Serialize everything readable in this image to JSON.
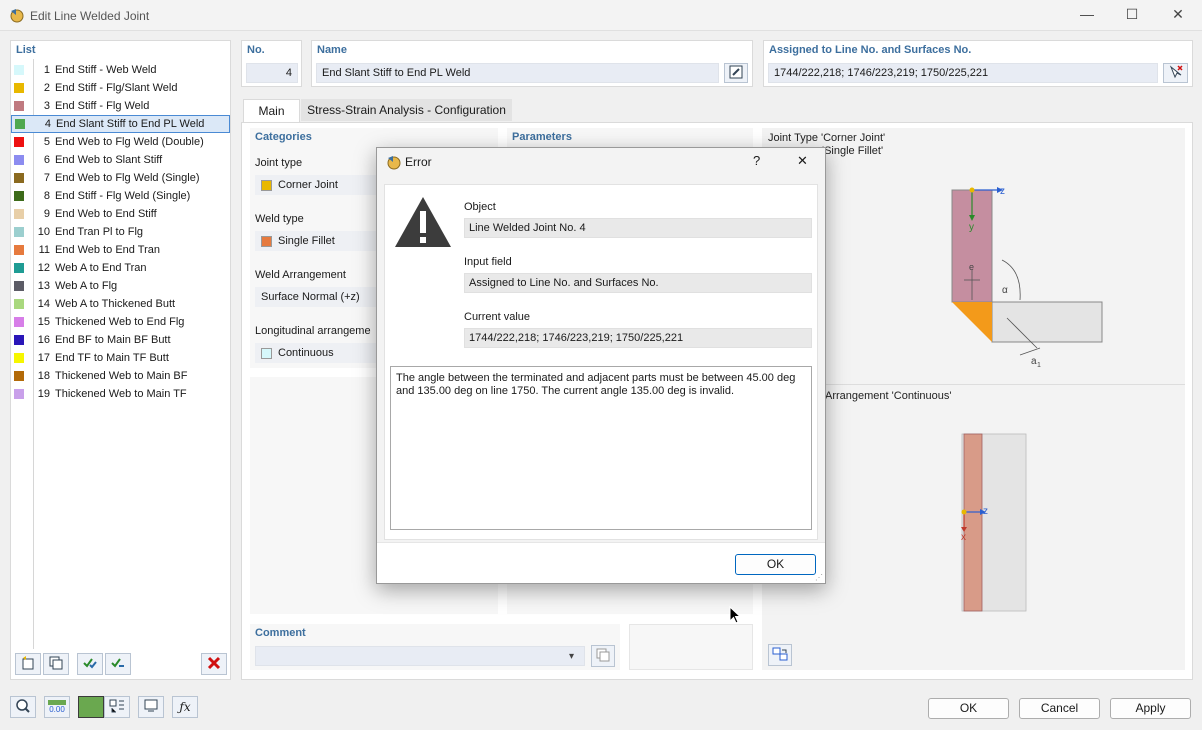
{
  "window": {
    "title": "Edit Line Welded Joint",
    "minimize_glyph": "—",
    "maximize_glyph": "☐",
    "close_glyph": "✕"
  },
  "list": {
    "header": "List",
    "selected_index": 3,
    "items": [
      {
        "num": "1",
        "label": "End Stiff - Web Weld",
        "color": "#d6f8fb"
      },
      {
        "num": "2",
        "label": "End Stiff - Flg/Slant Weld",
        "color": "#e8b800"
      },
      {
        "num": "3",
        "label": "End Stiff - Flg Weld",
        "color": "#c07a80"
      },
      {
        "num": "4",
        "label": "End Slant Stiff to End PL Weld",
        "color": "#4fa84f"
      },
      {
        "num": "5",
        "label": "End Web to Flg Weld (Double)",
        "color": "#ee1111"
      },
      {
        "num": "6",
        "label": "End Web to Slant Stiff",
        "color": "#8c8cf0"
      },
      {
        "num": "7",
        "label": "End Web to Flg Weld (Single)",
        "color": "#8b6a20"
      },
      {
        "num": "8",
        "label": "End Stiff - Flg Weld (Single)",
        "color": "#3d6b1a"
      },
      {
        "num": "9",
        "label": "End Web to End Stiff",
        "color": "#e8cfa8"
      },
      {
        "num": "10",
        "label": "End Tran Pl to Flg",
        "color": "#9ccfcf"
      },
      {
        "num": "11",
        "label": "End Web to End Tran",
        "color": "#e67a3e"
      },
      {
        "num": "12",
        "label": "Web A to End Tran",
        "color": "#1f9c94"
      },
      {
        "num": "13",
        "label": "Web A to Flg",
        "color": "#5c5c66"
      },
      {
        "num": "14",
        "label": "Web A to Thickened Butt",
        "color": "#a9d87e"
      },
      {
        "num": "15",
        "label": "Thickened Web to End Flg",
        "color": "#d77ee8"
      },
      {
        "num": "16",
        "label": "End BF to Main BF Butt",
        "color": "#2a16b8"
      },
      {
        "num": "17",
        "label": "End TF to Main TF Butt",
        "color": "#f6f600"
      },
      {
        "num": "18",
        "label": "Thickened Web to Main BF",
        "color": "#b36a08"
      },
      {
        "num": "19",
        "label": "Thickened Web to Main TF",
        "color": "#c9a0ea"
      }
    ]
  },
  "header_fields": {
    "no_label": "No.",
    "no_value": "4",
    "name_label": "Name",
    "name_value": "End Slant Stiff to End PL Weld",
    "assigned_label": "Assigned to Line No. and Surfaces No.",
    "assigned_value": "1744/222,218; 1746/223,219; 1750/225,221"
  },
  "tabs": [
    {
      "label": "Main",
      "active": true
    },
    {
      "label": "Stress-Strain Analysis - Configuration",
      "active": false
    }
  ],
  "categories": {
    "header": "Categories",
    "joint_type_label": "Joint type",
    "joint_type_value": "Corner Joint",
    "joint_type_color": "#e8b800",
    "weld_type_label": "Weld type",
    "weld_type_value": "Single Fillet",
    "weld_type_color": "#e67a3e",
    "weld_arrangement_label": "Weld Arrangement",
    "weld_arrangement_value": "Surface Normal (+z)",
    "longitudinal_label": "Longitudinal arrangeme",
    "longitudinal_value": "Continuous",
    "longitudinal_color": "#d6f8fb"
  },
  "parameters": {
    "header": "Parameters"
  },
  "comment": {
    "label": "Comment",
    "value": ""
  },
  "diagram": {
    "joint_type_caption": "Joint Type 'Corner Joint'",
    "weld_type_caption": "'Single Fillet'",
    "arrangement_caption": "al Arrangement 'Continuous'",
    "axis_z": "z",
    "axis_y": "y",
    "axis_x": "x",
    "label_e": "e",
    "label_alpha": "α",
    "label_a": "a",
    "label_a_sub": "1"
  },
  "dialog": {
    "title": "Error",
    "help_glyph": "?",
    "close_glyph": "✕",
    "object_label": "Object",
    "object_value": "Line Welded Joint No. 4",
    "input_field_label": "Input field",
    "input_field_value": "Assigned to Line No. and Surfaces No.",
    "current_value_label": "Current value",
    "current_value": "1744/222,218; 1746/223,219; 1750/225,221",
    "message": "The angle between the terminated and adjacent parts must be between 45.00 deg and 135.00 deg on line 1750. The current angle 135.00 deg is invalid.",
    "ok_label": "OK"
  },
  "footer": {
    "units_label": "0.00",
    "ok_label": "OK",
    "cancel_label": "Cancel",
    "apply_label": "Apply"
  },
  "icons": [
    "app-icon",
    "new-item-icon",
    "copy-item-icon",
    "check-all-icon",
    "check-selected-icon",
    "delete-icon",
    "edit-name-icon",
    "pick-lines-icon",
    "help-icon",
    "units-icon",
    "color-icon",
    "info-icon",
    "view-icon",
    "formula-icon",
    "swap-view-icon",
    "warning-icon",
    "comment-copy-icon"
  ]
}
